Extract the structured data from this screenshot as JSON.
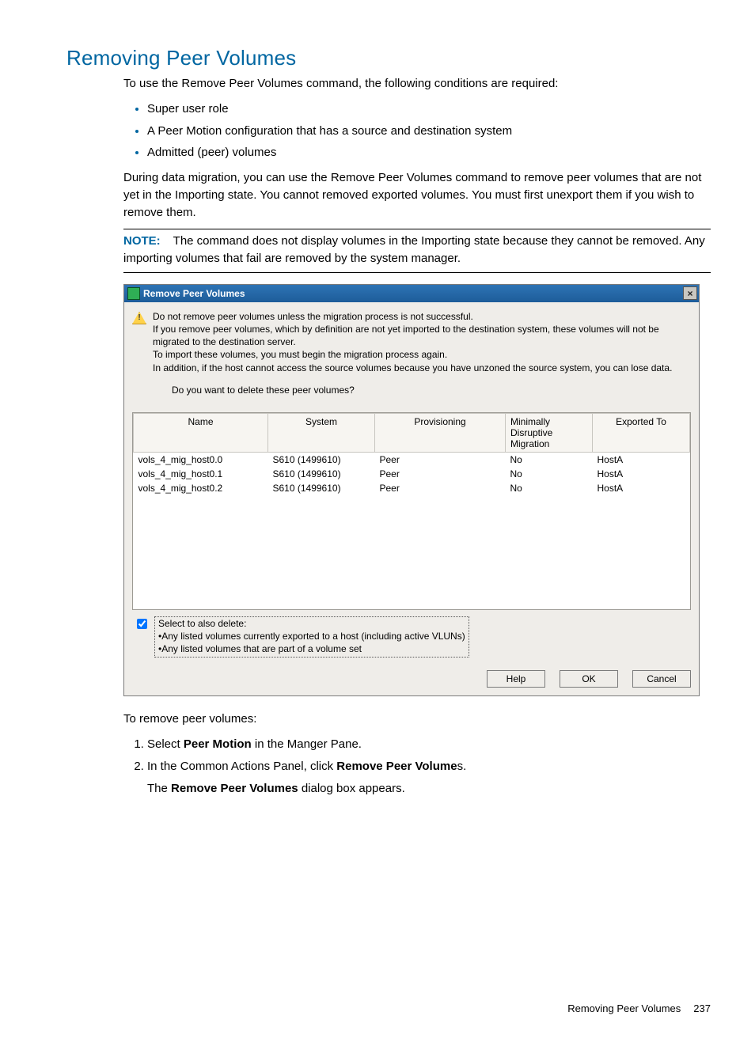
{
  "heading": "Removing Peer Volumes",
  "intro": "To use the Remove Peer Volumes command, the following conditions are required:",
  "requirements": [
    "Super user role",
    "A Peer Motion configuration that has a source and destination system",
    "Admitted (peer) volumes"
  ],
  "para2": "During data migration, you can use the Remove Peer Volumes command to remove peer volumes that are not yet in the Importing state. You cannot removed exported volumes. You must first unexport them if you wish to remove them.",
  "note_label": "NOTE:",
  "note_text": "The command does not display volumes in the Importing state because they cannot be removed. Any importing volumes that fail are removed by the system manager.",
  "dialog": {
    "title": "Remove Peer Volumes",
    "warning_lines": [
      "Do not remove peer volumes unless the migration process is not successful.",
      "If you remove peer volumes, which by definition are not yet imported to the destination system, these volumes will not be migrated to the destination server.",
      "To import these volumes, you must begin the migration process again.",
      "In addition, if the host cannot access the source volumes because you have unzoned the source system, you can lose data."
    ],
    "question": "Do you want to delete these peer volumes?",
    "columns": [
      "Name",
      "System",
      "Provisioning",
      "Minimally Disruptive Migration",
      "Exported To"
    ],
    "rows": [
      {
        "name": "vols_4_mig_host0.0",
        "system": "S610 (1499610)",
        "prov": "Peer",
        "mdm": "No",
        "exp": "HostA"
      },
      {
        "name": "vols_4_mig_host0.1",
        "system": "S610 (1499610)",
        "prov": "Peer",
        "mdm": "No",
        "exp": "HostA"
      },
      {
        "name": "vols_4_mig_host0.2",
        "system": "S610 (1499610)",
        "prov": "Peer",
        "mdm": "No",
        "exp": "HostA"
      }
    ],
    "also_delete_label": "Select to also delete:",
    "also_delete_items": [
      "Any listed volumes currently exported to a host (including active VLUNs)",
      "Any listed volumes that are part of a volume set"
    ],
    "buttons": {
      "help": "Help",
      "ok": "OK",
      "cancel": "Cancel"
    }
  },
  "steps_intro": "To remove peer volumes:",
  "steps": [
    {
      "pre": "Select ",
      "bold": "Peer Motion",
      "post": " in the Manger Pane."
    },
    {
      "pre": "In the Common Actions Panel, click ",
      "bold": "Remove Peer Volume",
      "post": "s.",
      "sub_pre": "The ",
      "sub_bold": "Remove Peer Volumes",
      "sub_post": " dialog box appears."
    }
  ],
  "footer": {
    "title": "Removing Peer Volumes",
    "page": "237"
  }
}
